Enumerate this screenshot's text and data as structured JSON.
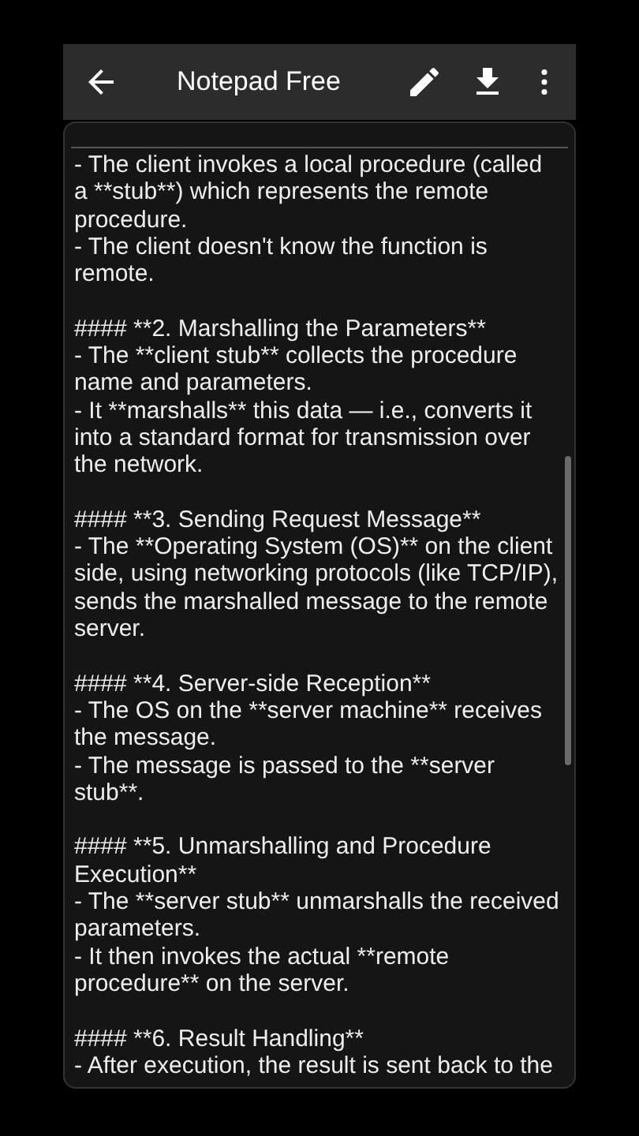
{
  "app_bar": {
    "title": "Notepad Free"
  },
  "note": {
    "blocks": [
      {
        "lines": [
          "- The client invokes a local procedure (called",
          "a **stub**) which represents the remote",
          "procedure.",
          "- The client doesn't know the function is",
          "remote."
        ]
      },
      {
        "lines": [
          "#### **2. Marshalling the Parameters**",
          "- The **client stub** collects the procedure",
          "name and parameters.",
          "- It **marshalls** this data — i.e., converts it",
          "into a standard format for transmission over",
          "the network."
        ]
      },
      {
        "lines": [
          "#### **3. Sending Request Message**",
          "- The **Operating System (OS)** on the client",
          "side, using networking protocols (like TCP/IP),",
          "sends the marshalled message to the remote",
          "server."
        ]
      },
      {
        "lines": [
          "#### **4. Server-side Reception**",
          "- The OS on the **server machine** receives",
          "the message.",
          "- The message is passed to the **server",
          "stub**."
        ]
      },
      {
        "lines": [
          "#### **5. Unmarshalling and Procedure",
          "Execution**",
          "- The **server stub** unmarshalls the received",
          "parameters.",
          "- It then invokes the actual **remote",
          "procedure** on the server."
        ]
      },
      {
        "lines": [
          "#### **6. Result Handling**",
          "- After execution, the result is sent back to the"
        ]
      }
    ]
  }
}
